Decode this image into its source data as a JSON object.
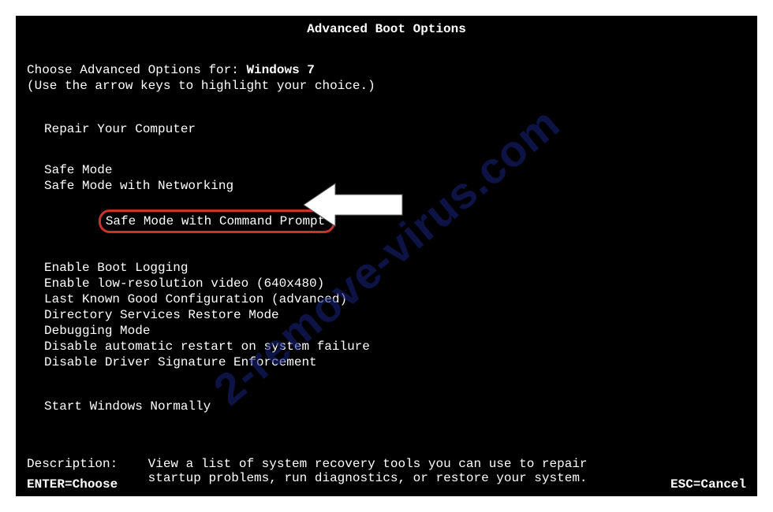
{
  "title": "Advanced Boot Options",
  "intro_prefix": "Choose Advanced Options for: ",
  "os_name": "Windows 7",
  "hint": "(Use the arrow keys to highlight your choice.)",
  "groups": {
    "repair": "Repair Your Computer",
    "safe": [
      "Safe Mode",
      "Safe Mode with Networking",
      "Safe Mode with Command Prompt"
    ],
    "advanced": [
      "Enable Boot Logging",
      "Enable low-resolution video (640x480)",
      "Last Known Good Configuration (advanced)",
      "Directory Services Restore Mode",
      "Debugging Mode",
      "Disable automatic restart on system failure",
      "Disable Driver Signature Enforcement"
    ],
    "normal": "Start Windows Normally"
  },
  "description_label": "Description:    ",
  "description_text": "View a list of system recovery tools you can use to repair startup problems, run diagnostics, or restore your system.",
  "footer": {
    "enter": "ENTER=Choose",
    "esc": "ESC=Cancel"
  },
  "watermark": "2-remove-virus.com"
}
